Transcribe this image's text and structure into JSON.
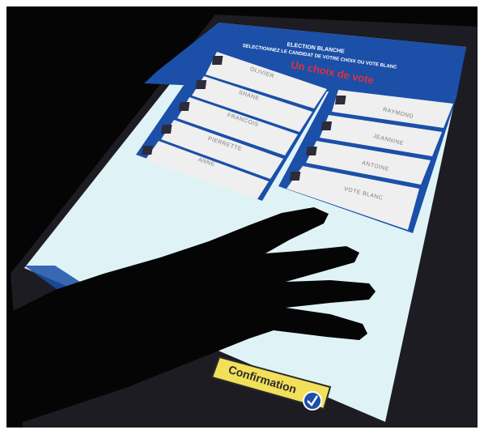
{
  "ballot": {
    "heading": "ELECTION BLANCHE",
    "instruction": "SELECTIONNEZ LE CANDIDAT DE VOTRE CHOIX OU VOTE BLANC",
    "subheading": "Un choix de vote",
    "left_candidates": [
      "OLIVIER",
      "SHANE",
      "FRANCOIS",
      "PIERRETTE",
      "ANNE"
    ],
    "right_candidates": [
      "RAYMOND",
      "JEANNINE",
      "ANTOINE",
      "VOTE BLANC"
    ]
  },
  "confirm": {
    "label": "Confirmation",
    "icon": "check-circle-icon"
  },
  "colors": {
    "header_blue": "#1b4fa8",
    "screen_bg": "#dff3f7",
    "card_bg": "#efefef",
    "accent_red": "#e0313c",
    "confirm_yellow": "#f2e05b"
  }
}
